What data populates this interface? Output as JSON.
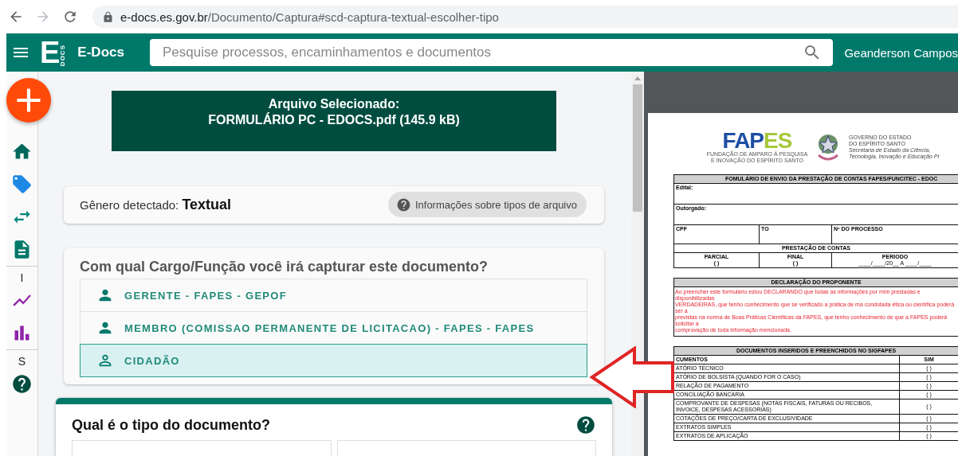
{
  "browser": {
    "url_host": "e-docs.es.gov.br",
    "url_path": "/Documento/Captura#scd-captura-textual-escolher-tipo"
  },
  "header": {
    "logo_letter": "E",
    "logo_sub": "DOCS",
    "app_name": "E-Docs",
    "search_placeholder": "Pesquise processos, encaminhamentos e documentos",
    "user": "Geanderson Campos"
  },
  "rail": [
    {
      "kind": "add"
    },
    {
      "kind": "home"
    },
    {
      "kind": "tags"
    },
    {
      "kind": "swap"
    },
    {
      "kind": "document"
    },
    {
      "kind": "section",
      "label": "I"
    },
    {
      "kind": "trend"
    },
    {
      "kind": "bars"
    },
    {
      "kind": "section",
      "label": "S"
    },
    {
      "kind": "help"
    }
  ],
  "selected_file": {
    "title": "Arquivo Selecionado:",
    "name": "FORMULÁRIO PC - EDOCS.pdf (145.9 kB)"
  },
  "genre": {
    "label": "Gênero detectado:",
    "value": "Textual",
    "info_button": "Informações sobre tipos de arquivo"
  },
  "role_picker": {
    "question": "Com qual Cargo/Função você irá capturar este documento?",
    "options": [
      {
        "label": "GERENTE - FAPES - GEPOF",
        "selected": false
      },
      {
        "label": "MEMBRO (COMISSAO PERMANENTE DE LICITACAO) - FAPES - FAPES",
        "selected": false
      },
      {
        "label": "CIDADÃO",
        "selected": true
      }
    ]
  },
  "doc_type": {
    "question": "Qual é o tipo do documento?"
  },
  "pdf": {
    "logo": {
      "part_1": "FAP",
      "part_2": "ES",
      "tagline": "FUNDAÇÃO DE AMPARO À PESQUISA E INOVAÇÃO DO ESPÍRITO SANTO"
    },
    "gov_lines": [
      "GOVERNO DO ESTADO",
      "DO ESPÍRITO SANTO"
    ],
    "secretariat_lines": [
      "Secretaria de Estado da Ciência,",
      "Tecnologia, Inovação e Educação Pr"
    ],
    "form": {
      "title": "FOMULÁRIO DE ENVIO DA PRESTAÇÃO DE CONTAS FAPES/FUNCITEC - EDOC",
      "edital": "Edital:",
      "outorgado": "Outorgado:",
      "cpf": "CPF",
      "to": "TO",
      "processo": "Nº DO PROCESSO",
      "section": "PRESTAÇÃO DE CONTAS",
      "parcial": "PARCIAL",
      "parcial_box": "( )",
      "final": "FINAL",
      "final_box": "( )",
      "periodo": "PERIODO",
      "periodo_value": "____/____/20__ A ____/____"
    },
    "declaration": {
      "title": "DECLARAÇÃO DO PROPONENTE",
      "lines": [
        "Ao preencher este formulário estou DECLARANDO que todas as informações por mim prestadas e disponibilizadas",
        "VERDADEIRAS, que tenho conhecimento que se verificado a prática de má condutada ética ou científica poderá ser a",
        "previstas na norma de Boas Práticas Científicas da FAPES, que tenho conhecimento de que a FAPES poderá solicitar a",
        "comprovação de toda informação mencionada."
      ]
    },
    "documents": {
      "title": "DOCUMENTOS INSERIDOS E PREENCHIDOS NO SIGFAPES",
      "column_1": "CUMENTOS",
      "column_2": "SIM",
      "rows": [
        {
          "name": "ATÓRIO TÉCNICO",
          "mark": "( )"
        },
        {
          "name": "ATÓRIO DE BOLSISTA (QUANDO FOR O CASO)",
          "mark": "( )"
        },
        {
          "name": "RELAÇÃO DE PAGAMENTO",
          "mark": "( )"
        },
        {
          "name": "CONCILIAÇÃO BANCARIA",
          "mark": "( )"
        },
        {
          "name": "COMPROVANTE DE DESPESAS (NOTAS FISCAIS, FATURAS OU RECIBOS, INVOICE, DESPESAS ACESSORIAS)",
          "mark": "( )"
        },
        {
          "name": "COTAÇÕES DE PREÇO/CARTA DE EXCLUSIVIDADE",
          "mark": "( )"
        },
        {
          "name": "EXTRATOS SIMPLES",
          "mark": "( )"
        },
        {
          "name": "EXTRATOS DE APLICAÇÃO",
          "mark": "( )"
        }
      ]
    }
  }
}
